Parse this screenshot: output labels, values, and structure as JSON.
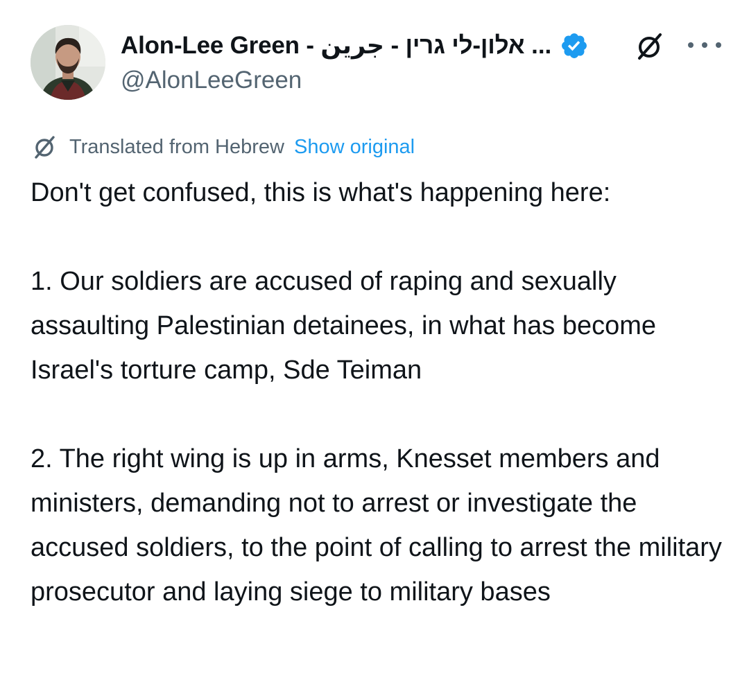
{
  "author": {
    "display_name": "Alon-Lee Green - אלון-לי גרין - جرين ...",
    "handle": "@AlonLeeGreen",
    "verified": true,
    "avatar": "profile-photo"
  },
  "header_icons": {
    "grok_icon": "grok-icon",
    "more_icon": "more-icon"
  },
  "translation": {
    "label": "Translated from Hebrew",
    "show_original": "Show original"
  },
  "tweet": {
    "paragraphs": [
      "Don't get confused, this is what's happening here:",
      "1. Our soldiers are accused of raping and sexually assaulting Palestinian detainees, in what has become Israel's torture camp, Sde Teiman",
      "2. The right wing is up in arms, Knesset members and ministers, demanding not to arrest or investigate the accused soldiers, to the point of calling to arrest the military prosecutor and laying siege to military bases"
    ]
  },
  "colors": {
    "text": "#0f1419",
    "secondary": "#536471",
    "link": "#1d9bf0",
    "verified_badge": "#1d9bf0"
  }
}
